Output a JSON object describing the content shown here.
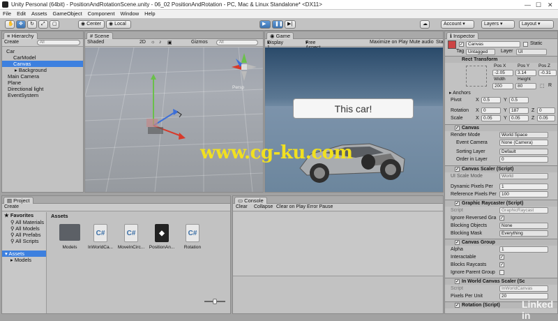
{
  "window": {
    "title": "Unity Personal (64bit) - PositionAndRotationScene.unity - 06_02 PositionAndRotation - PC, Mac & Linux Standalone* <DX11>"
  },
  "menu": [
    "File",
    "Edit",
    "Assets",
    "GameObject",
    "Component",
    "Window",
    "Help"
  ],
  "toolbar": {
    "center": "Center",
    "local": "Local",
    "account": "Account",
    "layers": "Layers",
    "layout": "Layout"
  },
  "hierarchy": {
    "tab": "Hierarchy",
    "create": "Create",
    "search_placeholder": "All",
    "items": [
      "Car",
      "CarModel",
      "Canvas",
      "Background",
      "Main Camera",
      "Plane",
      "Directional light",
      "EventSystem"
    ]
  },
  "scene": {
    "tab": "Scene",
    "shading": "Shaded",
    "mode2d": "2D",
    "gizmos": "Gizmos",
    "search": "All",
    "persp": "Persp"
  },
  "game": {
    "tab": "Game",
    "display": "Display 1",
    "aspect": "Free Aspect",
    "maximize": "Maximize on Play",
    "mute": "Mute audio",
    "stats": "Sta",
    "button_text": "This car!"
  },
  "inspector": {
    "tab": "Inspector",
    "name": "Canvas",
    "static": "Static",
    "tag_label": "Tag",
    "tag": "Untagged",
    "layer_label": "Layer",
    "layer": "UI",
    "rect": {
      "title": "Rect Transform",
      "posx_label": "Pos X",
      "posy_label": "Pos Y",
      "posz_label": "Pos Z",
      "posx": "-2.05",
      "posy": "3.14",
      "posz": "-0.31",
      "width_label": "Width",
      "height_label": "Height",
      "width": "200",
      "height": "80",
      "anchors": "Anchors",
      "pivot": "Pivot",
      "pivot_x": "0.5",
      "pivot_y": "0.5",
      "rotation": "Rotation",
      "rot_x": "0",
      "rot_y": "187",
      "rot_z": "0",
      "scale": "Scale",
      "scale_x": "0.05",
      "scale_y": "0.05",
      "scale_z": "0.05"
    },
    "canvas": {
      "title": "Canvas",
      "render_mode_label": "Render Mode",
      "render_mode": "World Space",
      "event_camera_label": "Event Camera",
      "event_camera": "None (Camera)",
      "sorting_layer_label": "Sorting Layer",
      "sorting_layer": "Default",
      "order_label": "Order in Layer",
      "order": "0"
    },
    "scaler": {
      "title": "Canvas Scaler (Script)",
      "ui_scale_label": "UI Scale Mode",
      "ui_scale": "World",
      "dpp_label": "Dynamic Pixels Per",
      "dpp": "1",
      "rpp_label": "Reference Pixels Per",
      "rpp": "100"
    },
    "raycaster": {
      "title": "Graphic Raycaster (Script)",
      "script_label": "Script",
      "script": "GraphicRaycast",
      "ignore_label": "Ignore Reversed Gra",
      "blocking_label": "Blocking Objects",
      "blocking": "None",
      "mask_label": "Blocking Mask",
      "mask": "Everything"
    },
    "group": {
      "title": "Canvas Group",
      "alpha_label": "Alpha",
      "alpha": "1",
      "interactable": "Interactable",
      "blocks": "Blocks Raycasts",
      "ignore_parent": "Ignore Parent Group"
    },
    "inworld": {
      "title": "In World Canvas Scaler (Sc",
      "script_label": "Script",
      "script": "InWorldCanvas",
      "ppu_label": "Pixels Per Unit",
      "ppu": "20"
    },
    "rotation": {
      "title": "Rotation (Script)"
    }
  },
  "project": {
    "tab": "Project",
    "create": "Create",
    "favorites": "Favorites",
    "fav_items": [
      "All Materials",
      "All Models",
      "All Prefabs",
      "All Scripts"
    ],
    "assets_root": "Assets",
    "assets_children": [
      "Models"
    ],
    "breadcrumb": "Assets",
    "files": [
      {
        "name": "Models",
        "kind": "folder"
      },
      {
        "name": "InWorldCa...",
        "kind": "script"
      },
      {
        "name": "MoveInCirc...",
        "kind": "script"
      },
      {
        "name": "PositionAn...",
        "kind": "unity"
      },
      {
        "name": "Rotation",
        "kind": "script"
      }
    ]
  },
  "console": {
    "tab": "Console",
    "clear": "Clear",
    "collapse": "Collapse",
    "clear_on_play": "Clear on Play",
    "error_pause": "Error Pause"
  },
  "watermarks": {
    "left": "www.cg-ku.com",
    "right": "Linked in"
  }
}
